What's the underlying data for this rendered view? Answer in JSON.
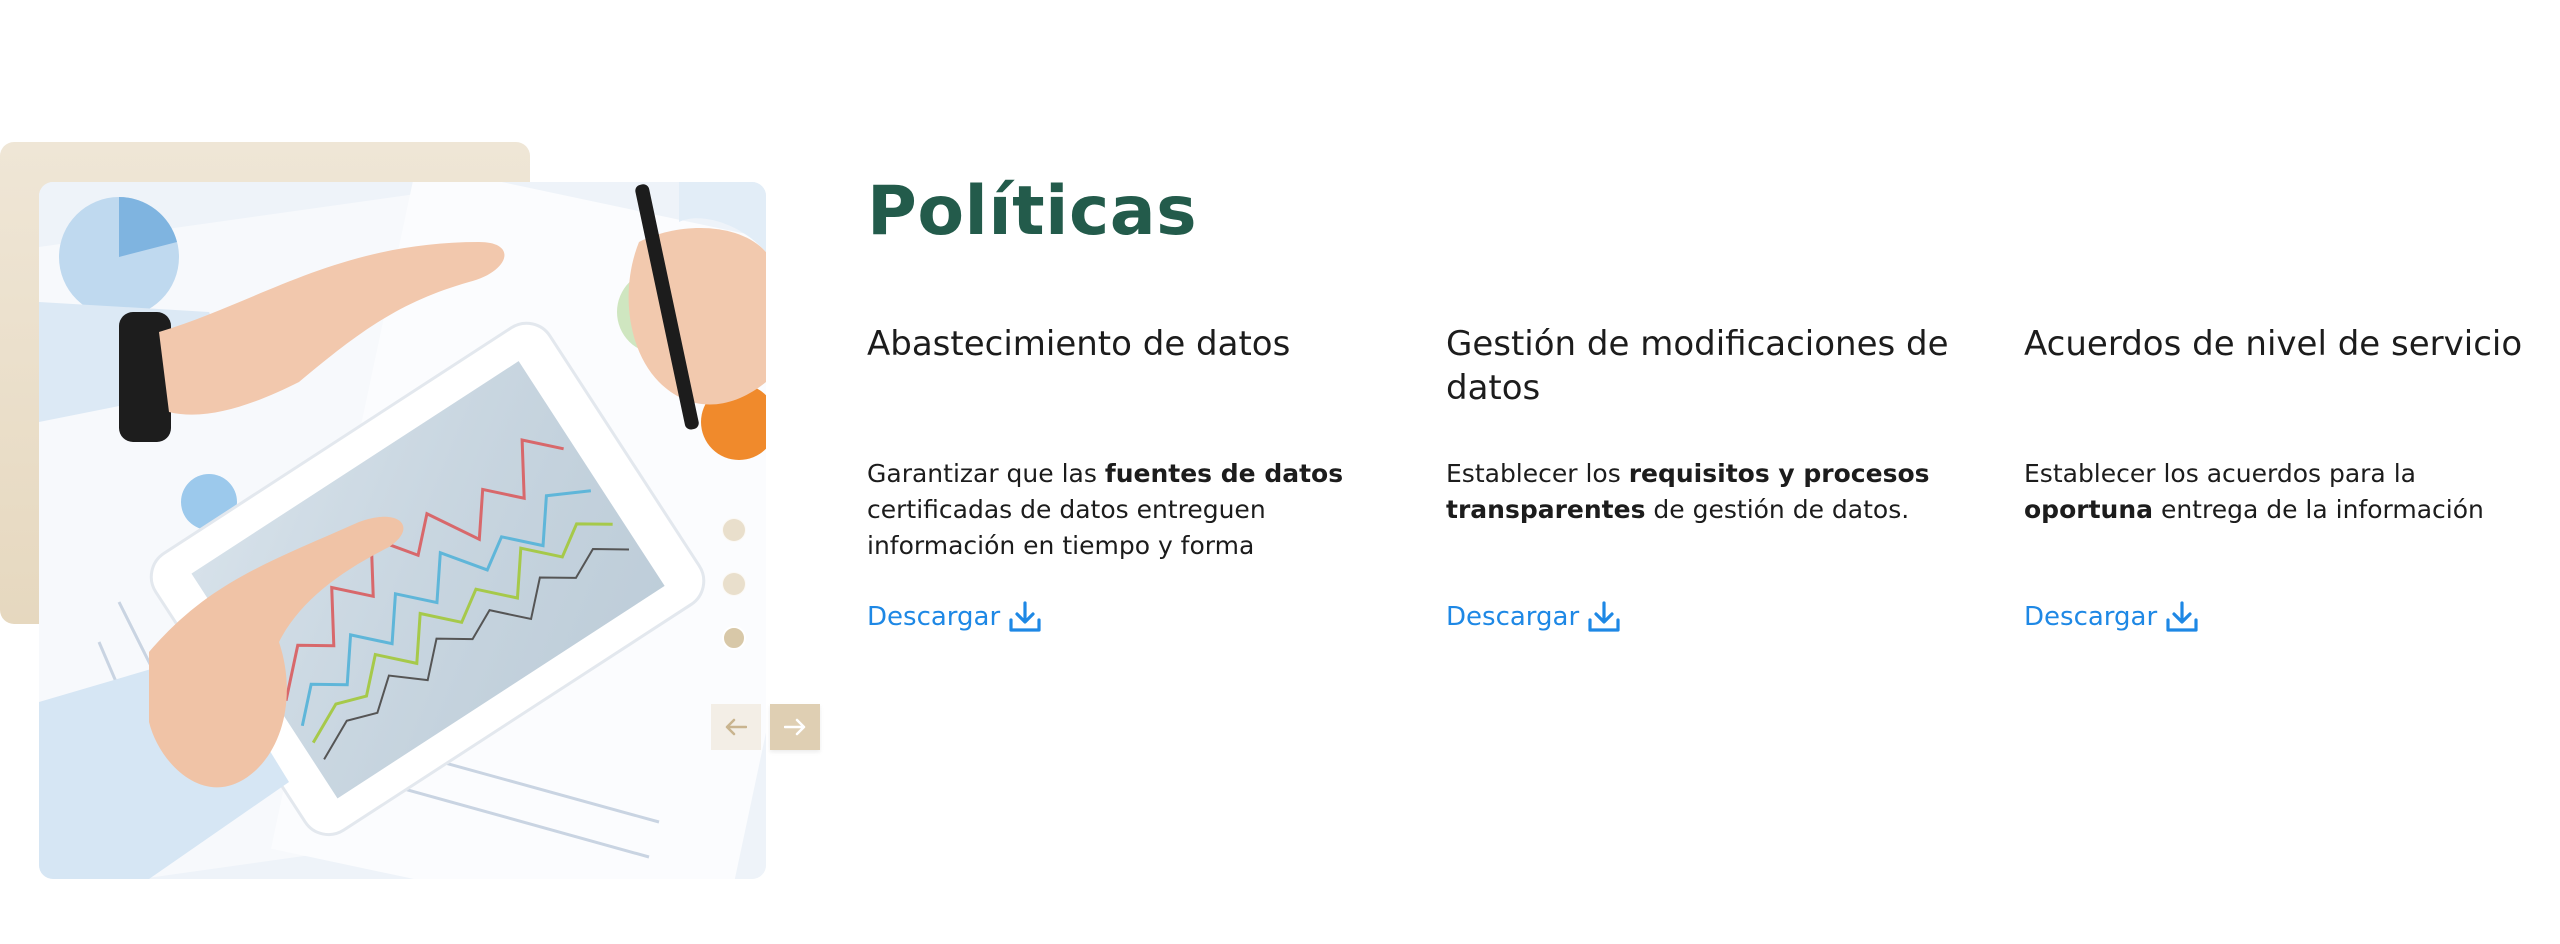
{
  "section": {
    "title": "Políticas"
  },
  "policies": [
    {
      "heading": "Abastecimiento de datos",
      "desc_pre": "Garantizar que las ",
      "desc_bold": "fuentes de datos",
      "desc_post": " certificadas de datos entreguen información en tiempo y forma",
      "link": "Descargar"
    },
    {
      "heading": "Gestión de modificaciones de datos",
      "desc_pre": "Establecer los ",
      "desc_bold": "requisitos y procesos transparentes",
      "desc_post": " de gestión de datos.",
      "link": "Descargar"
    },
    {
      "heading": "Acuerdos de nivel de servicio",
      "desc_pre": "Establecer los acuerdos para la ",
      "desc_bold": "oportuna",
      "desc_post": " entrega de la información",
      "link": "Descargar"
    }
  ],
  "carousel": {
    "slide_count": 3,
    "active_slide": 3
  },
  "colors": {
    "title": "#235b4b",
    "link": "#1e88e5",
    "accent_beige": "#dfcfb3"
  },
  "icons": {
    "download": "download-icon",
    "prev": "arrow-left-icon",
    "next": "arrow-right-icon"
  }
}
